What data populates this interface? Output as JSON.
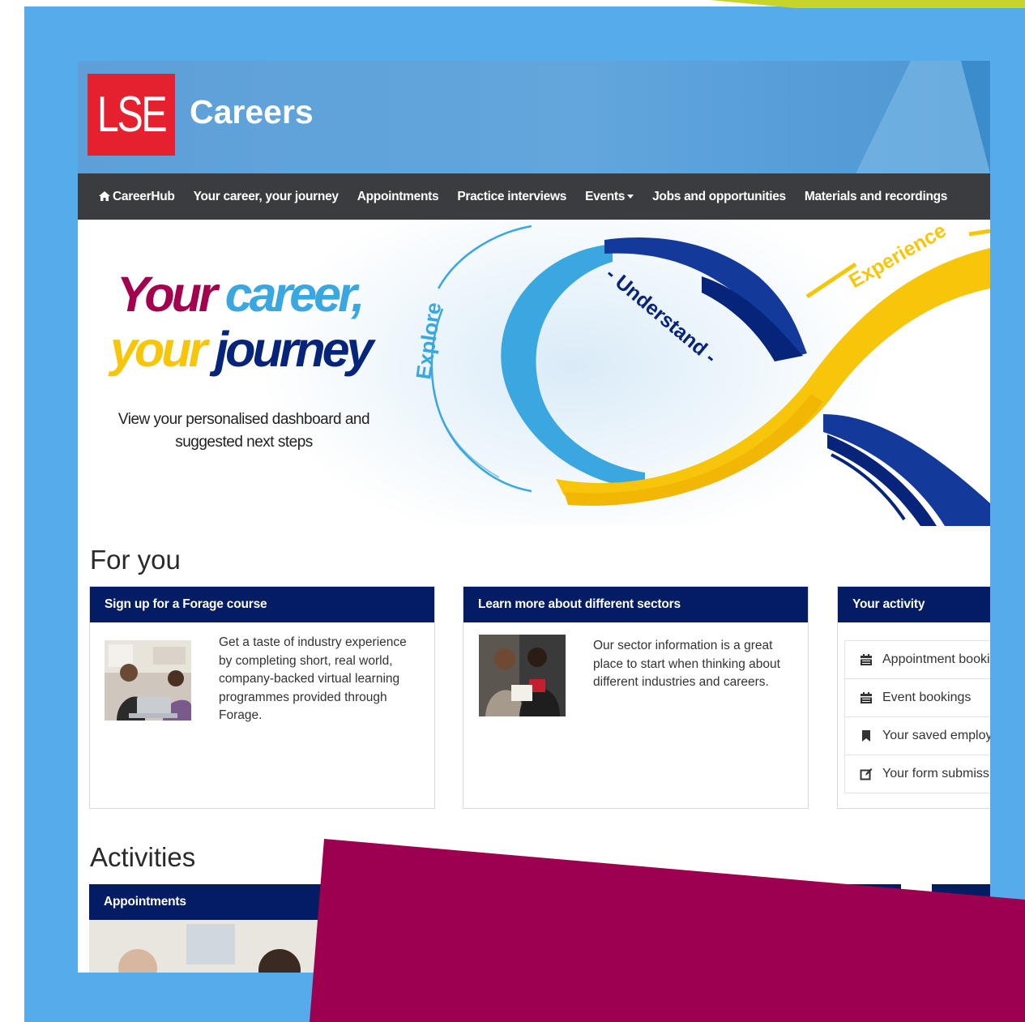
{
  "header": {
    "logo_text": "LSE",
    "title": "Careers",
    "colors": {
      "logo_red": "#e5202f",
      "header_blue": "#5e9fd7",
      "frame_blue": "#56acea",
      "maroon": "#9c004e",
      "navy": "#031c63"
    }
  },
  "nav": {
    "items": [
      {
        "label": "CareerHub",
        "icon": "home-icon"
      },
      {
        "label": "Your career, your journey"
      },
      {
        "label": "Appointments"
      },
      {
        "label": "Practice interviews"
      },
      {
        "label": "Events",
        "has_dropdown": true
      },
      {
        "label": "Jobs and opportunities"
      },
      {
        "label": "Materials and recordings"
      }
    ]
  },
  "hero": {
    "line1_a": "Your",
    "line1_b": "career,",
    "line2_a": "your",
    "line2_b": "journey",
    "subtitle": "View your personalised dashboard and suggested next steps",
    "ribbon_words": {
      "explore": "Explore",
      "understand": "- Understand -",
      "experience": "Experience"
    }
  },
  "for_you": {
    "heading": "For you",
    "cards": [
      {
        "title": "Sign up for a Forage course",
        "text": "Get a taste of industry experience by completing short, real world, company-backed virtual learning programmes provided through Forage."
      },
      {
        "title": "Learn more about different sectors",
        "text": "Our sector information is a great place to start when thinking about different industries and careers."
      }
    ],
    "activity": {
      "title": "Your activity",
      "items": [
        {
          "label": "Appointment bookings",
          "icon": "calendar-icon"
        },
        {
          "label": "Event bookings",
          "icon": "calendar-icon"
        },
        {
          "label": "Your saved employers",
          "icon": "bookmark-icon"
        },
        {
          "label": "Your form submissions",
          "icon": "edit-icon"
        }
      ]
    }
  },
  "activities": {
    "heading": "Activities",
    "cards": [
      {
        "title": "Appointments"
      }
    ]
  }
}
